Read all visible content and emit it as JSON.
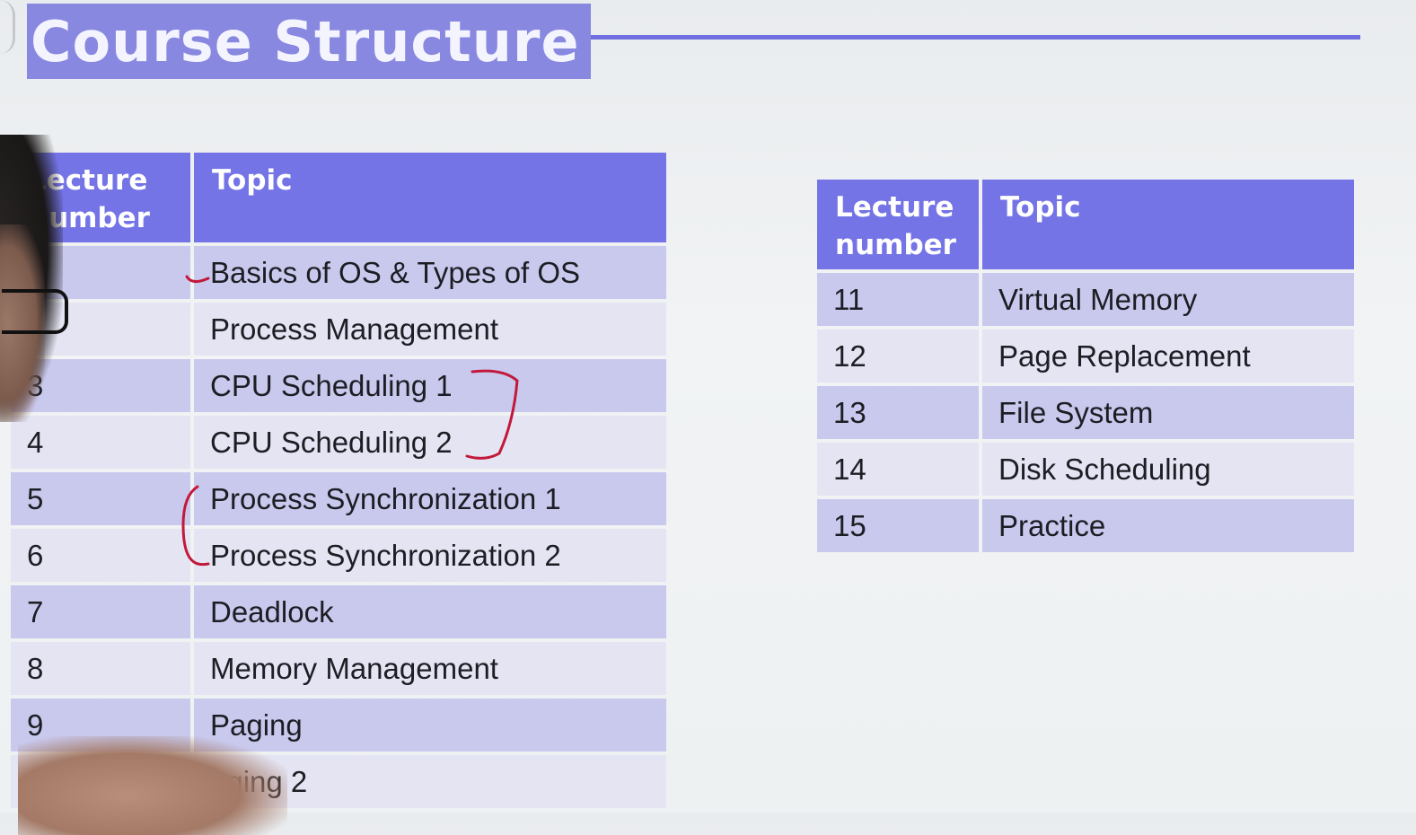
{
  "title": "Course Structure",
  "colors": {
    "title_band": "#8888e0",
    "header": "#7474e6",
    "row_dark": "#c9c9ee",
    "row_light": "#e4e4f3",
    "annotation": "#c2183a"
  },
  "left_table": {
    "headers": {
      "number": "Lecture number",
      "topic": "Topic"
    },
    "rows": [
      {
        "number": "",
        "topic": "Basics of OS & Types of OS"
      },
      {
        "number": "",
        "topic": "Process Management"
      },
      {
        "number": "3",
        "topic": "CPU Scheduling 1"
      },
      {
        "number": "4",
        "topic": "CPU Scheduling 2"
      },
      {
        "number": "5",
        "topic": "Process Synchronization 1"
      },
      {
        "number": "6",
        "topic": "Process Synchronization 2"
      },
      {
        "number": "7",
        "topic": "Deadlock"
      },
      {
        "number": "8",
        "topic": "Memory Management"
      },
      {
        "number": "9",
        "topic": "Paging"
      },
      {
        "number": "",
        "topic": "aging 2"
      }
    ]
  },
  "right_table": {
    "headers": {
      "number": "Lecture number",
      "topic": "Topic"
    },
    "rows": [
      {
        "number": "11",
        "topic": "Virtual Memory"
      },
      {
        "number": "12",
        "topic": "Page Replacement"
      },
      {
        "number": "13",
        "topic": "File System"
      },
      {
        "number": "14",
        "topic": "Disk Scheduling"
      },
      {
        "number": "15",
        "topic": "Practice"
      }
    ]
  }
}
